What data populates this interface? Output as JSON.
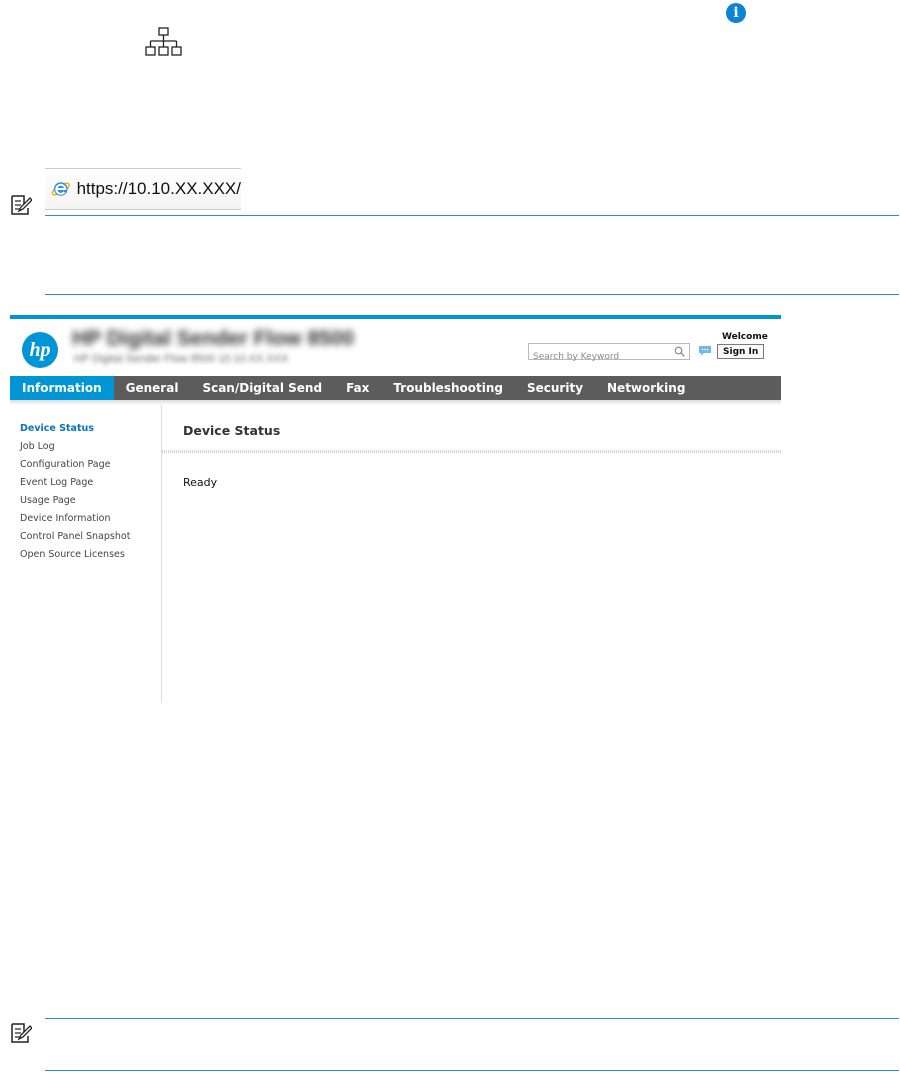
{
  "address_bar": {
    "url": "https://10.10.XX.XXX/"
  },
  "ews": {
    "header": {
      "logo_text": "hp",
      "product_name": "HP Digital Sender Flow 8500",
      "product_subtitle": "HP Digital Sender Flow 8500    10.10.XX.XXX",
      "search_placeholder": "Search by Keyword",
      "welcome_label": "Welcome",
      "sign_in_label": "Sign In"
    },
    "nav_tabs": [
      {
        "label": "Information",
        "active": true
      },
      {
        "label": "General"
      },
      {
        "label": "Scan/Digital Send"
      },
      {
        "label": "Fax"
      },
      {
        "label": "Troubleshooting"
      },
      {
        "label": "Security"
      },
      {
        "label": "Networking"
      }
    ],
    "sidebar_items": [
      {
        "label": "Device Status",
        "active": true
      },
      {
        "label": "Job Log"
      },
      {
        "label": "Configuration Page"
      },
      {
        "label": "Event Log Page"
      },
      {
        "label": "Usage Page"
      },
      {
        "label": "Device Information"
      },
      {
        "label": "Control Panel Snapshot"
      },
      {
        "label": "Open Source Licenses"
      }
    ],
    "content": {
      "title": "Device Status",
      "status": "Ready"
    }
  },
  "icons": {
    "info": "info-icon",
    "network": "network-icon",
    "browser": "ie-icon",
    "note": "note-icon",
    "search": "search-icon",
    "chat": "chat-icon"
  },
  "colors": {
    "hp_blue": "#0096d6",
    "nav_gray": "#5c5c5c",
    "note_rule": "#2a8fd0"
  }
}
